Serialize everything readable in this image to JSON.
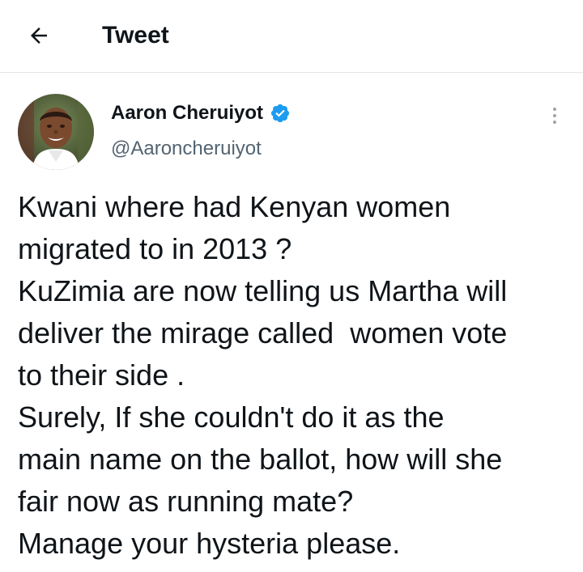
{
  "header": {
    "back_icon": "arrow-left-icon",
    "title": "Tweet"
  },
  "author": {
    "name": "Aaron Cheruiyot",
    "handle": "@Aaroncheruiyot",
    "verified_icon": "verified-badge-icon",
    "avatar_icon": "avatar-photo",
    "verified_color": "#1d9bf0"
  },
  "more_icon": "more-vertical-icon",
  "tweet": {
    "lines": [
      "Kwani where had Kenyan women",
      "migrated to in 2013 ?",
      "KuZimia are now telling us Martha will",
      "deliver the mirage called  women vote",
      "to their side .",
      "Surely, If she couldn't do it as the",
      "main name on the ballot, how will she",
      "fair now as running mate?",
      "Manage your hysteria please."
    ]
  },
  "colors": {
    "text": "#0f1419",
    "secondary": "#536471",
    "border": "#e6e6e6"
  }
}
